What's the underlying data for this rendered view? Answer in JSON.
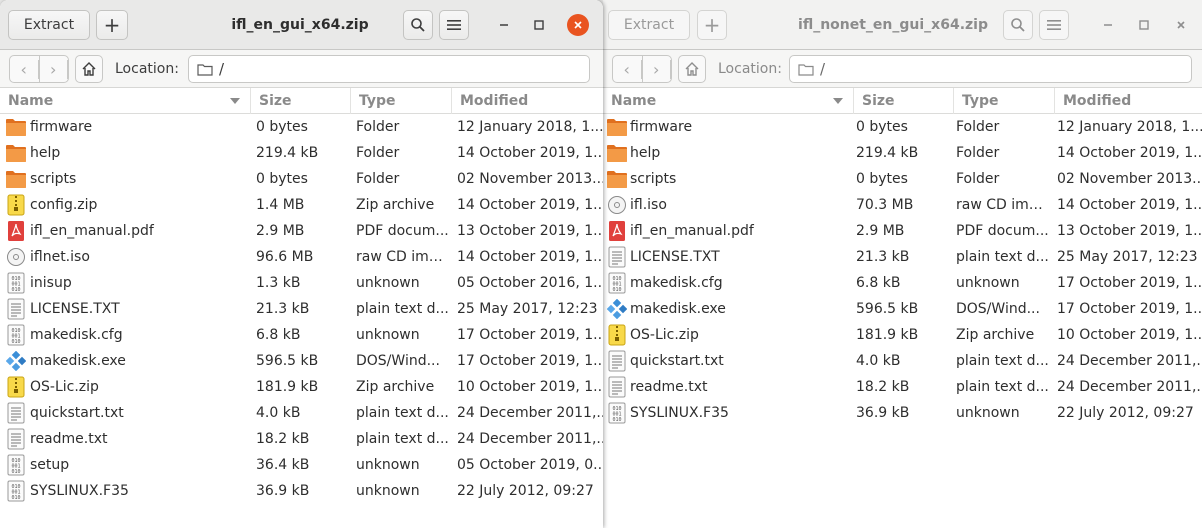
{
  "left": {
    "title": "ifl_en_gui_x64.zip",
    "extract_label": "Extract",
    "location_label": "Location:",
    "location_value": "/",
    "columns": {
      "name": "Name",
      "size": "Size",
      "type": "Type",
      "modified": "Modified"
    },
    "files": [
      {
        "icon": "folder-icon",
        "name": "firmware",
        "size": "0 bytes",
        "type": "Folder",
        "modified": "12 January 2018, 1..."
      },
      {
        "icon": "folder-icon",
        "name": "help",
        "size": "219.4 kB",
        "type": "Folder",
        "modified": "14 October 2019, 1..."
      },
      {
        "icon": "folder-icon",
        "name": "scripts",
        "size": "0 bytes",
        "type": "Folder",
        "modified": "02 November 2013..."
      },
      {
        "icon": "zip-icon",
        "name": "config.zip",
        "size": "1.4 MB",
        "type": "Zip archive",
        "modified": "14 October 2019, 1..."
      },
      {
        "icon": "pdf-icon",
        "name": "ifl_en_manual.pdf",
        "size": "2.9 MB",
        "type": "PDF docum...",
        "modified": "13 October 2019, 1..."
      },
      {
        "icon": "disc-icon",
        "name": "iflnet.iso",
        "size": "96.6 MB",
        "type": "raw CD image",
        "modified": "14 October 2019, 1..."
      },
      {
        "icon": "binary-icon",
        "name": "inisup",
        "size": "1.3 kB",
        "type": "unknown",
        "modified": "05 October 2016, 1..."
      },
      {
        "icon": "text-icon",
        "name": "LICENSE.TXT",
        "size": "21.3 kB",
        "type": "plain text d...",
        "modified": "25 May 2017, 12:23"
      },
      {
        "icon": "binary-icon",
        "name": "makedisk.cfg",
        "size": "6.8 kB",
        "type": "unknown",
        "modified": "17 October 2019, 1..."
      },
      {
        "icon": "exe-icon",
        "name": "makedisk.exe",
        "size": "596.5 kB",
        "type": "DOS/Wind...",
        "modified": "17 October 2019, 1..."
      },
      {
        "icon": "zip-icon",
        "name": "OS-Lic.zip",
        "size": "181.9 kB",
        "type": "Zip archive",
        "modified": "10 October 2019, 1..."
      },
      {
        "icon": "text-icon",
        "name": "quickstart.txt",
        "size": "4.0 kB",
        "type": "plain text d...",
        "modified": "24 December 2011,..."
      },
      {
        "icon": "text-icon",
        "name": "readme.txt",
        "size": "18.2 kB",
        "type": "plain text d...",
        "modified": "24 December 2011,..."
      },
      {
        "icon": "binary-icon",
        "name": "setup",
        "size": "36.4 kB",
        "type": "unknown",
        "modified": "05 October 2019, 0..."
      },
      {
        "icon": "binary-icon",
        "name": "SYSLINUX.F35",
        "size": "36.9 kB",
        "type": "unknown",
        "modified": "22 July 2012, 09:27"
      }
    ]
  },
  "right": {
    "title": "ifl_nonet_en_gui_x64.zip",
    "extract_label": "Extract",
    "location_label": "Location:",
    "location_value": "/",
    "columns": {
      "name": "Name",
      "size": "Size",
      "type": "Type",
      "modified": "Modified"
    },
    "files": [
      {
        "icon": "folder-icon",
        "name": "firmware",
        "size": "0 bytes",
        "type": "Folder",
        "modified": "12 January 2018, 1..."
      },
      {
        "icon": "folder-icon",
        "name": "help",
        "size": "219.4 kB",
        "type": "Folder",
        "modified": "14 October 2019, 1..."
      },
      {
        "icon": "folder-icon",
        "name": "scripts",
        "size": "0 bytes",
        "type": "Folder",
        "modified": "02 November 2013..."
      },
      {
        "icon": "disc-icon",
        "name": "ifl.iso",
        "size": "70.3 MB",
        "type": "raw CD image",
        "modified": "14 October 2019, 1..."
      },
      {
        "icon": "pdf-icon",
        "name": "ifl_en_manual.pdf",
        "size": "2.9 MB",
        "type": "PDF docum...",
        "modified": "13 October 2019, 1..."
      },
      {
        "icon": "text-icon",
        "name": "LICENSE.TXT",
        "size": "21.3 kB",
        "type": "plain text d...",
        "modified": "25 May 2017, 12:23"
      },
      {
        "icon": "binary-icon",
        "name": "makedisk.cfg",
        "size": "6.8 kB",
        "type": "unknown",
        "modified": "17 October 2019, 1..."
      },
      {
        "icon": "exe-icon",
        "name": "makedisk.exe",
        "size": "596.5 kB",
        "type": "DOS/Wind...",
        "modified": "17 October 2019, 1..."
      },
      {
        "icon": "zip-icon",
        "name": "OS-Lic.zip",
        "size": "181.9 kB",
        "type": "Zip archive",
        "modified": "10 October 2019, 1..."
      },
      {
        "icon": "text-icon",
        "name": "quickstart.txt",
        "size": "4.0 kB",
        "type": "plain text d...",
        "modified": "24 December 2011,..."
      },
      {
        "icon": "text-icon",
        "name": "readme.txt",
        "size": "18.2 kB",
        "type": "plain text d...",
        "modified": "24 December 2011,..."
      },
      {
        "icon": "binary-icon",
        "name": "SYSLINUX.F35",
        "size": "36.9 kB",
        "type": "unknown",
        "modified": "22 July 2012, 09:27"
      }
    ]
  },
  "colors": {
    "accent": "#e95420",
    "folder": "#f08a3a",
    "zip": "#f5c518",
    "pdf": "#e0403c"
  }
}
